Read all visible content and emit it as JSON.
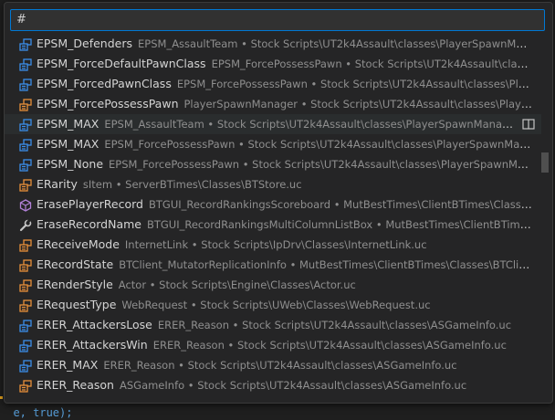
{
  "colors": {
    "enum_blue": "#3b8eea",
    "enum_member_orange": "#e8903a",
    "struct_purple": "#b180d7",
    "wrench_gray": "#c5c5c5",
    "accent": "#0078d4"
  },
  "search": {
    "value": "#"
  },
  "editor": {
    "peek_text": "e, true);"
  },
  "items": [
    {
      "icon": "enum-icon",
      "label": "EPSM_Defenders",
      "detail": "EPSM_AssaultTeam • Stock Scripts\\UT2k4Assault\\classes\\PlayerSpawnManager.uc"
    },
    {
      "icon": "enum-icon",
      "label": "EPSM_ForceDefaultPawnClass",
      "detail": "EPSM_ForcePossessPawn • Stock Scripts\\UT2k4Assault\\classes\\Player..."
    },
    {
      "icon": "enum-icon",
      "label": "EPSM_ForcedPawnClass",
      "detail": "EPSM_ForcePossessPawn • Stock Scripts\\UT2k4Assault\\classes\\PlayerSpaw..."
    },
    {
      "icon": "enum-member-icon",
      "label": "EPSM_ForcePossessPawn",
      "detail": "PlayerSpawnManager • Stock Scripts\\UT2k4Assault\\classes\\PlayerSpawn..."
    },
    {
      "icon": "enum-icon",
      "label": "EPSM_MAX",
      "detail": "EPSM_AssaultTeam • Stock Scripts\\UT2k4Assault\\classes\\PlayerSpawnManager.uc",
      "hover": true
    },
    {
      "icon": "enum-icon",
      "label": "EPSM_MAX",
      "detail": "EPSM_ForcePossessPawn • Stock Scripts\\UT2k4Assault\\classes\\PlayerSpawnManager.uc"
    },
    {
      "icon": "enum-icon",
      "label": "EPSM_None",
      "detail": "EPSM_ForcePossessPawn • Stock Scripts\\UT2k4Assault\\classes\\PlayerSpawnManager.uc"
    },
    {
      "icon": "enum-member-icon",
      "label": "ERarity",
      "detail": "sItem • ServerBTimes\\Classes\\BTStore.uc"
    },
    {
      "icon": "struct-icon",
      "label": "ErasePlayerRecord",
      "detail": "BTGUI_RecordRankingsScoreboard • MutBestTimes\\ClientBTimes\\Classes\\Scoreb..."
    },
    {
      "icon": "wrench-icon",
      "label": "EraseRecordName",
      "detail": "BTGUI_RecordRankingsMultiColumnListBox • MutBestTimes\\ClientBTimes\\Classes..."
    },
    {
      "icon": "enum-member-icon",
      "label": "EReceiveMode",
      "detail": "InternetLink • Stock Scripts\\IpDrv\\Classes\\InternetLink.uc"
    },
    {
      "icon": "enum-member-icon",
      "label": "ERecordState",
      "detail": "BTClient_MutatorReplicationInfo • MutBestTimes\\ClientBTimes\\Classes\\BTClient_Mutat..."
    },
    {
      "icon": "enum-member-icon",
      "label": "ERenderStyle",
      "detail": "Actor • Stock Scripts\\Engine\\Classes\\Actor.uc"
    },
    {
      "icon": "enum-member-icon",
      "label": "ERequestType",
      "detail": "WebRequest • Stock Scripts\\UWeb\\Classes\\WebRequest.uc"
    },
    {
      "icon": "enum-icon",
      "label": "ERER_AttackersLose",
      "detail": "ERER_Reason • Stock Scripts\\UT2k4Assault\\classes\\ASGameInfo.uc"
    },
    {
      "icon": "enum-icon",
      "label": "ERER_AttackersWin",
      "detail": "ERER_Reason • Stock Scripts\\UT2k4Assault\\classes\\ASGameInfo.uc"
    },
    {
      "icon": "enum-icon",
      "label": "ERER_MAX",
      "detail": "ERER_Reason • Stock Scripts\\UT2k4Assault\\classes\\ASGameInfo.uc"
    },
    {
      "icon": "enum-member-icon",
      "label": "ERER_Reason",
      "detail": "ASGameInfo • Stock Scripts\\UT2k4Assault\\classes\\ASGameInfo.uc"
    }
  ]
}
